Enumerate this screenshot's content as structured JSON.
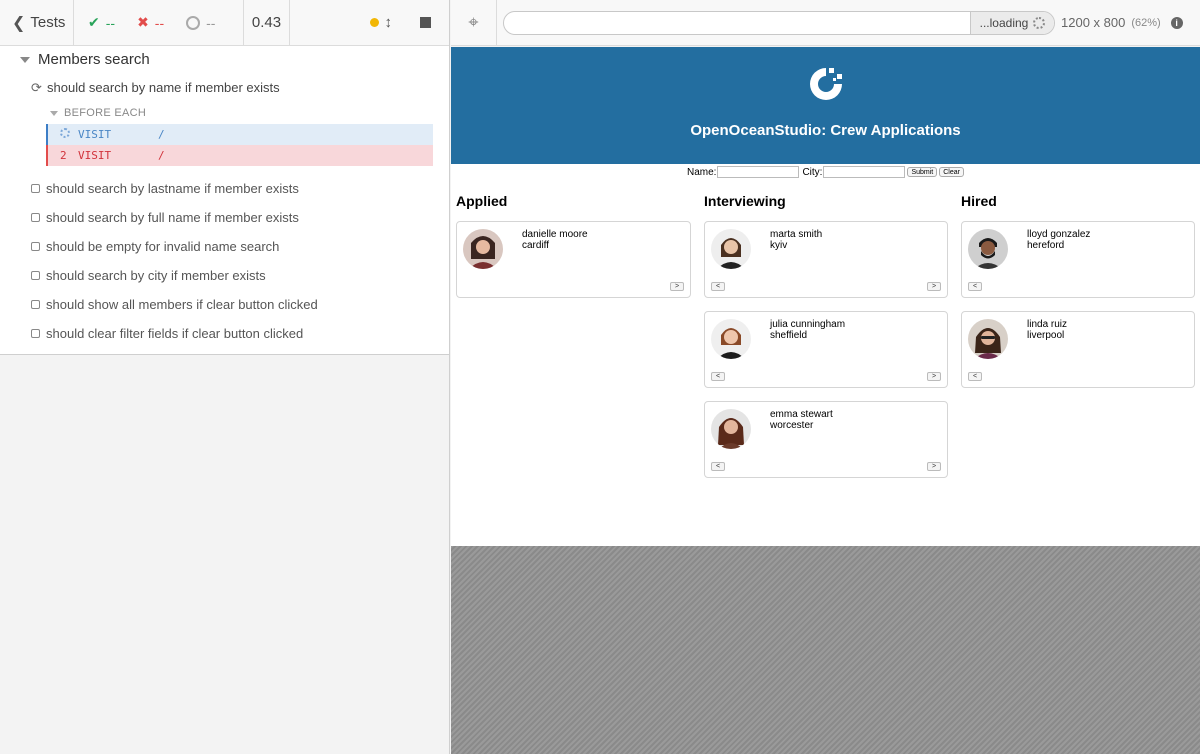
{
  "reporter": {
    "tests_label": "Tests",
    "stats": {
      "passed": "--",
      "failed": "--",
      "pending": "--"
    },
    "duration": "0.43",
    "suite_title": "Members search",
    "running_test": "should search by name if member exists",
    "hook_label": "BEFORE EACH",
    "commands": [
      {
        "num": "",
        "name": "VISIT",
        "arg": "/"
      },
      {
        "num": "2",
        "name": "VISIT",
        "arg": "/"
      }
    ],
    "tests": [
      "should search by lastname if member exists",
      "should search by full name if member exists",
      "should be empty for invalid name search",
      "should search by city if member exists",
      "should show all members if clear button clicked",
      "should clear filter fields if clear button clicked"
    ]
  },
  "aut": {
    "url_value": "",
    "loading_label": "...loading",
    "viewport": "1200 x 800",
    "scale": "(62%)"
  },
  "app": {
    "title": "OpenOceanStudio: Crew Applications",
    "filter": {
      "name_label": "Name:",
      "city_label": "City:",
      "submit": "Submit",
      "clear": "Clear"
    },
    "columns": [
      {
        "title": "Applied",
        "members": [
          {
            "name": "danielle moore",
            "city": "cardiff",
            "left_btn": "",
            "right_btn": ">"
          }
        ]
      },
      {
        "title": "Interviewing",
        "members": [
          {
            "name": "marta smith",
            "city": "kyiv",
            "left_btn": "<",
            "right_btn": ">"
          },
          {
            "name": "julia cunningham",
            "city": "sheffield",
            "left_btn": "<",
            "right_btn": ">"
          },
          {
            "name": "emma stewart",
            "city": "worcester",
            "left_btn": "<",
            "right_btn": ">"
          }
        ]
      },
      {
        "title": "Hired",
        "members": [
          {
            "name": "lloyd gonzalez",
            "city": "hereford",
            "left_btn": "<",
            "right_btn": ""
          },
          {
            "name": "linda ruiz",
            "city": "liverpool",
            "left_btn": "<",
            "right_btn": ""
          }
        ]
      }
    ]
  },
  "colors": {
    "banner": "#236ea0",
    "pass": "#29a35a",
    "fail": "#e24c4b",
    "active_cmd": "#e1ecf7",
    "failed_cmd": "#f8d7da"
  }
}
